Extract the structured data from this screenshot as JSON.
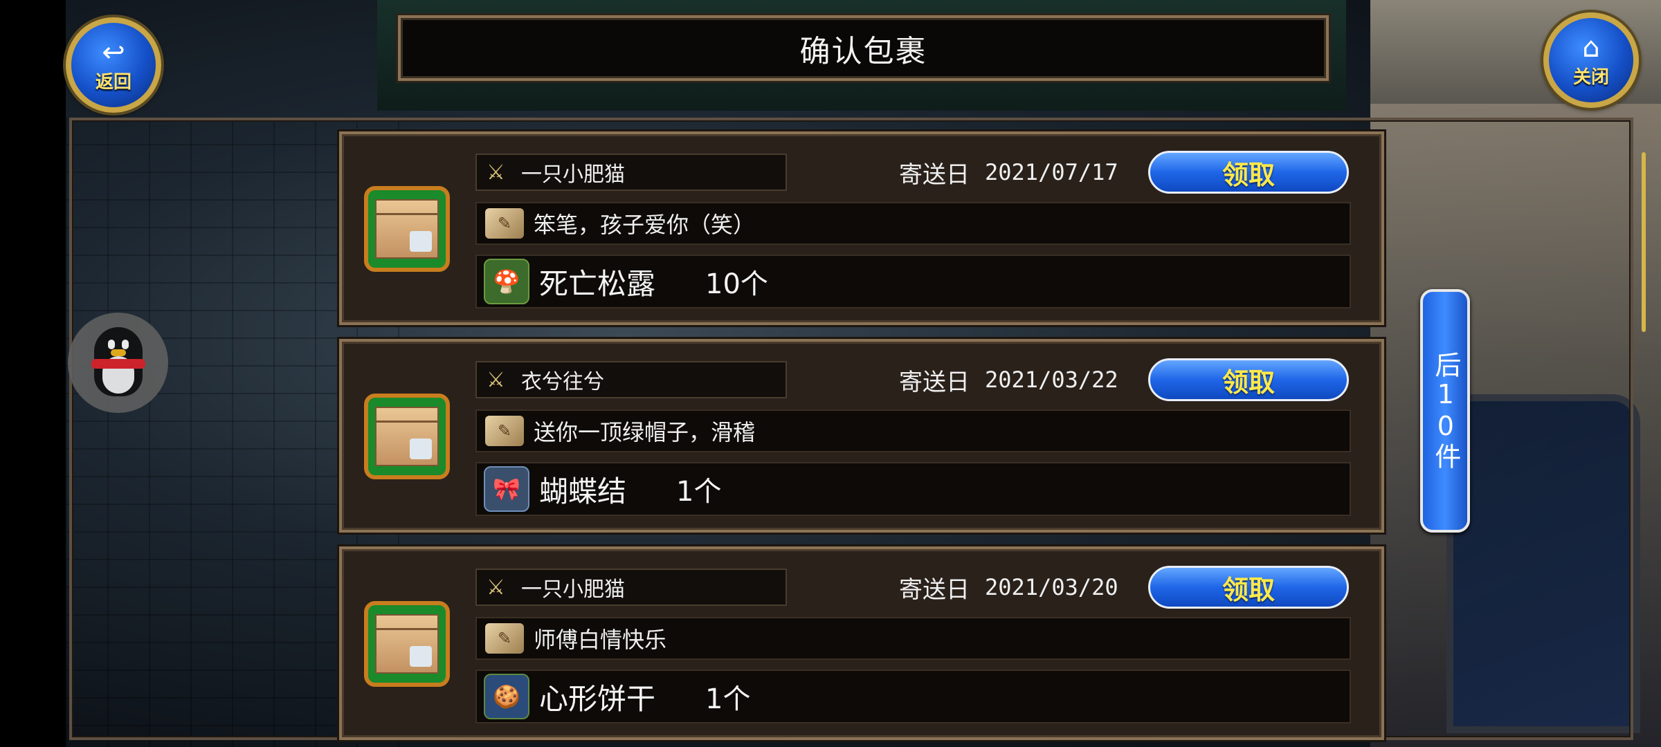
{
  "header": {
    "title": "确认包裹"
  },
  "nav": {
    "back_label": "返回",
    "close_label": "关闭",
    "next_page_label": "后10件"
  },
  "parcel_labels": {
    "send_date_label": "寄送日",
    "claim_label": "领取"
  },
  "parcels": [
    {
      "sender": "一只小肥猫",
      "date": "2021/07/17",
      "message": "笨笔，孩子爱你（笑）",
      "item_name": "死亡松露",
      "quantity": "10个",
      "item_icon": "truffle-icon"
    },
    {
      "sender": "衣兮往兮",
      "date": "2021/03/22",
      "message": "送你一顶绿帽子，滑稽",
      "item_name": "蝴蝶结",
      "quantity": "1个",
      "item_icon": "bow-icon"
    },
    {
      "sender": "一只小肥猫",
      "date": "2021/03/20",
      "message": "师傅白情快乐",
      "item_name": "心形饼干",
      "quantity": "1个",
      "item_icon": "cookie-icon"
    }
  ],
  "colors": {
    "accent_blue": "#1f66e8",
    "claim_text": "#ffe94a",
    "frame": "#8b7355",
    "box_green": "#1a8a2a"
  }
}
